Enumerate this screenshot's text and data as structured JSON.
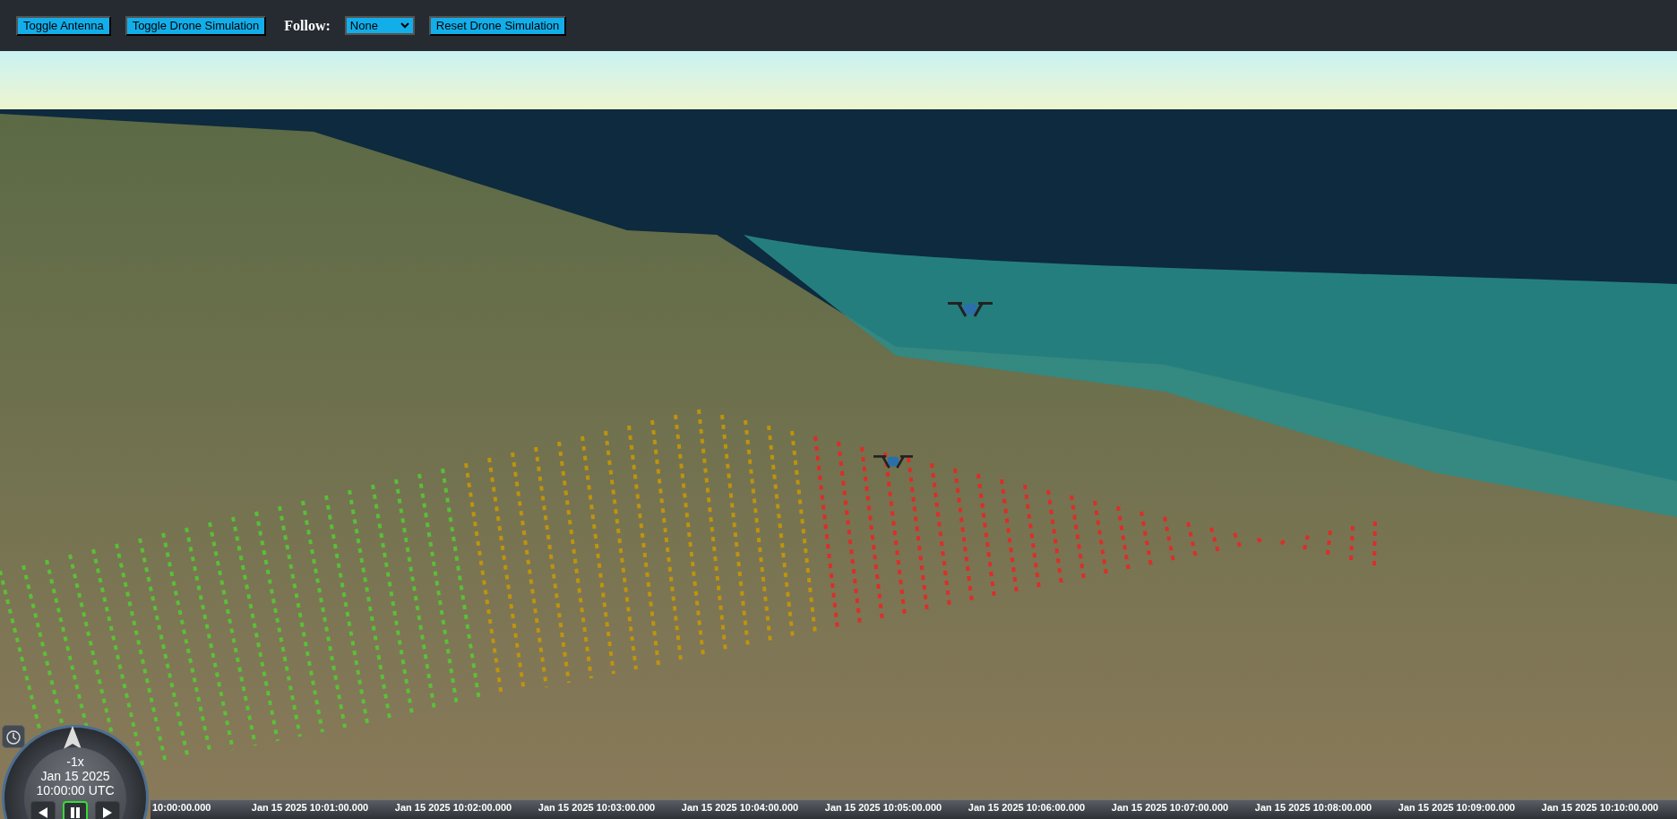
{
  "toolbar": {
    "items": [
      {
        "kind": "button",
        "label": "Toggle Antenna"
      },
      {
        "kind": "button",
        "label": "Toggle Drone Simulation"
      },
      {
        "kind": "select",
        "label": "Follow:",
        "value": "None"
      },
      {
        "kind": "button",
        "label": "Reset Drone Simulation"
      }
    ]
  },
  "animation": {
    "speed": "-1x",
    "date": "Jan 15 2025",
    "time": "10:00:00 UTC",
    "controls": [
      {
        "kind": "reverse",
        "selected": false
      },
      {
        "kind": "pause",
        "selected": true
      },
      {
        "kind": "play",
        "selected": false
      }
    ]
  },
  "timeline": {
    "labels": [
      "10:00:00.000",
      "Jan 15 2025 10:01:00.000",
      "Jan 15 2025 10:02:00.000",
      "Jan 15 2025 10:03:00.000",
      "Jan 15 2025 10:04:00.000",
      "Jan 15 2025 10:05:00.000",
      "Jan 15 2025 10:06:00.000",
      "Jan 15 2025 10:07:00.000",
      "Jan 15 2025 10:08:00.000",
      "Jan 15 2025 10:09:00.000",
      "Jan 15 2025 10:10:00.000"
    ]
  }
}
